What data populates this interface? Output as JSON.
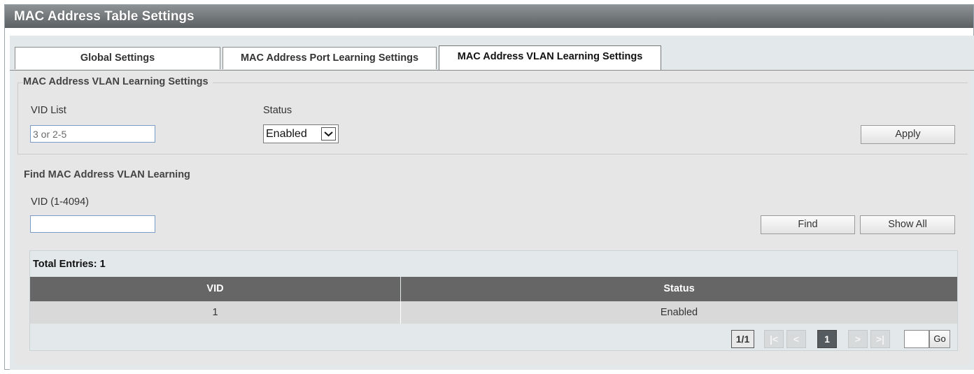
{
  "title": "MAC Address Table Settings",
  "tabs": [
    {
      "label": "Global Settings"
    },
    {
      "label": "MAC Address Port Learning Settings"
    },
    {
      "label": "MAC Address VLAN Learning Settings"
    }
  ],
  "active_tab": "MAC Address VLAN Learning Settings",
  "settings": {
    "legend": "MAC Address VLAN Learning Settings",
    "vid_list_label": "VID List",
    "vid_list_placeholder": "3 or 2-5",
    "status_label": "Status",
    "status_value": "Enabled",
    "apply_label": "Apply"
  },
  "find": {
    "heading": "Find MAC Address VLAN Learning",
    "vid_label": "VID (1-4094)",
    "vid_value": "",
    "find_label": "Find",
    "show_all_label": "Show All"
  },
  "table": {
    "total": "Total Entries: 1",
    "columns": [
      "VID",
      "Status"
    ],
    "rows": [
      [
        "1",
        "Enabled"
      ]
    ]
  },
  "pagination": {
    "info": "1/1",
    "first": "|<",
    "prev": "<",
    "current": "1",
    "next": ">",
    "last": ">|",
    "go_label": "Go"
  },
  "icons": {
    "status_dropdown": "chevron-down-icon"
  },
  "colors": {
    "title_bar": "#6f7477",
    "table_header": "#666666",
    "current_page": "#555b5f"
  }
}
